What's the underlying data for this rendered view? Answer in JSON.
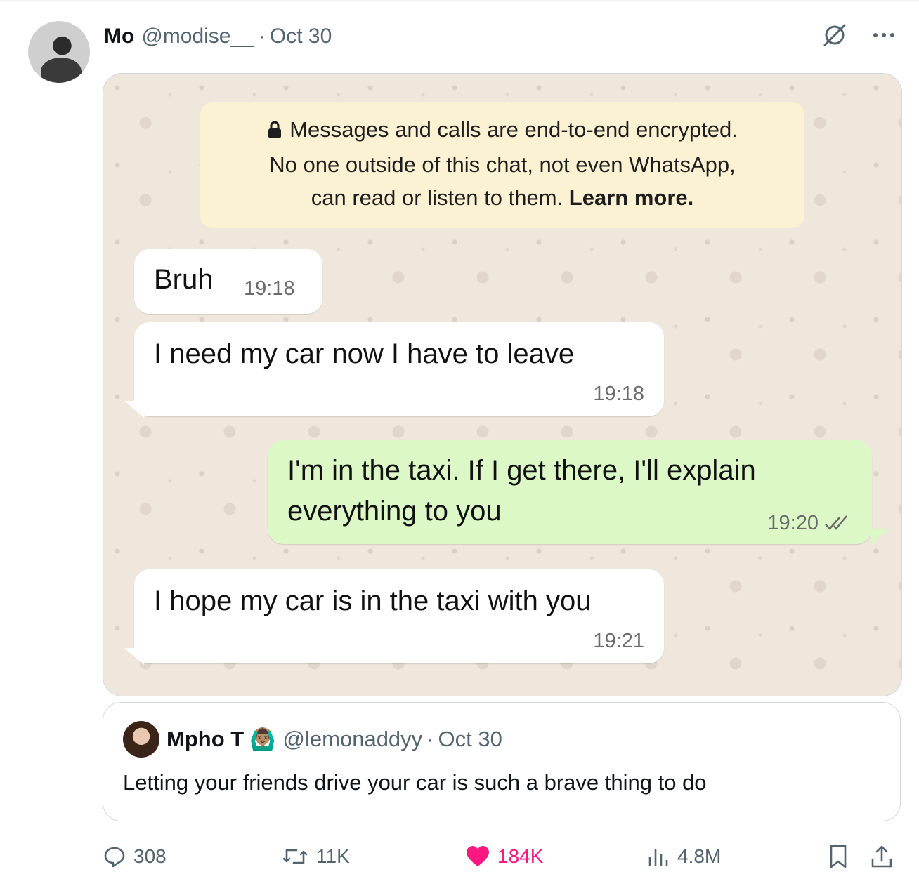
{
  "post": {
    "author_name": "Mo",
    "author_handle": "@modise__",
    "separator": "·",
    "date": "Oct 30"
  },
  "icons": {
    "top": [
      "grok-icon",
      "more-icon"
    ],
    "actions": [
      "reply-icon",
      "retweet-icon",
      "like-icon",
      "views-icon",
      "bookmark-icon",
      "share-icon"
    ]
  },
  "chat": {
    "encryption_notice": {
      "line1": "Messages and calls are end-to-end encrypted.",
      "line2": "No one outside of this chat, not even WhatsApp,",
      "line3_prefix": "can read or listen to them.",
      "learn_more": "Learn more."
    },
    "messages": [
      {
        "direction": "incoming",
        "text": "Bruh",
        "time": "19:18"
      },
      {
        "direction": "incoming",
        "text": "I need my car now I have to leave",
        "time": "19:18"
      },
      {
        "direction": "outgoing",
        "line1": "I'm in the taxi. If I get there, I'll explain",
        "line2": "everything to you",
        "time": "19:20",
        "read": true
      },
      {
        "direction": "incoming",
        "text": "I hope my car is in the taxi with you",
        "time": "19:21"
      }
    ]
  },
  "quoted": {
    "author_name": "Mpho T",
    "badge_emoji": "🙆🏽‍♂️",
    "author_handle": "@lemonaddyy",
    "separator": "·",
    "date": "Oct 30",
    "text": "Letting your friends drive your car is such a brave thing to do"
  },
  "stats": {
    "replies": "308",
    "reposts": "11K",
    "likes": "184K",
    "views": "4.8M"
  },
  "colors": {
    "like": "#f91880",
    "secondary_text": "#536471",
    "outgoing_bubble": "#dcf8c6",
    "chat_background": "#efe7dc",
    "notice_background": "#fbf1d3",
    "read_ticks": "#53bdeb"
  }
}
